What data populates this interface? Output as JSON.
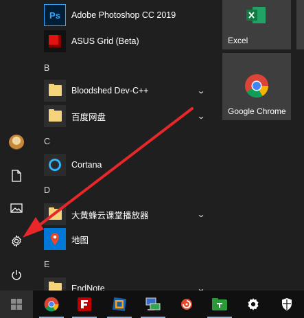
{
  "rail": {
    "items": [
      {
        "name": "user-avatar",
        "icon": "avatar"
      },
      {
        "name": "documents",
        "icon": "document-icon"
      },
      {
        "name": "pictures",
        "icon": "picture-icon"
      },
      {
        "name": "settings",
        "icon": "gear-icon"
      },
      {
        "name": "power",
        "icon": "power-icon"
      }
    ]
  },
  "applist": {
    "apps": [
      {
        "label": "Adobe Photoshop CC 2019",
        "icon": "photoshop-icon",
        "icon_text": "Ps"
      },
      {
        "label": "ASUS Grid (Beta)",
        "icon": "asus-grid-icon"
      },
      {
        "label": "Bloodshed Dev-C++",
        "icon": "folder-icon",
        "expandable": true
      },
      {
        "label": "百度网盘",
        "icon": "folder-icon",
        "expandable": true
      },
      {
        "label": "Cortana",
        "icon": "cortana-icon"
      },
      {
        "label": "大黄蜂云课堂播放器",
        "icon": "folder-icon",
        "expandable": true
      },
      {
        "label": "地图",
        "icon": "maps-icon"
      },
      {
        "label": "EndNote",
        "icon": "folder-icon",
        "expandable": true
      }
    ],
    "letters": [
      "B",
      "C",
      "D",
      "E"
    ],
    "chevron": "⌄"
  },
  "tiles": {
    "excel": {
      "label": "Excel",
      "icon": "excel-icon",
      "color": "#1e7145"
    },
    "chrome": {
      "label": "Google Chrome",
      "icon": "chrome-icon"
    }
  },
  "taskbar": {
    "items": [
      {
        "name": "start",
        "icon": "windows-logo-icon"
      },
      {
        "name": "chrome",
        "icon": "chrome-icon"
      },
      {
        "name": "filezilla",
        "icon": "filezilla-icon"
      },
      {
        "name": "virtualbox",
        "icon": "virtualbox-icon"
      },
      {
        "name": "network-app",
        "icon": "network-monitor-icon"
      },
      {
        "name": "snail-app",
        "icon": "snail-icon"
      },
      {
        "name": "green-app",
        "icon": "green-folder-icon"
      },
      {
        "name": "settings",
        "icon": "gear-icon"
      },
      {
        "name": "security",
        "icon": "shield-icon"
      }
    ]
  },
  "annotation": {
    "type": "arrow",
    "color": "#e8272a",
    "points_to": "settings"
  }
}
